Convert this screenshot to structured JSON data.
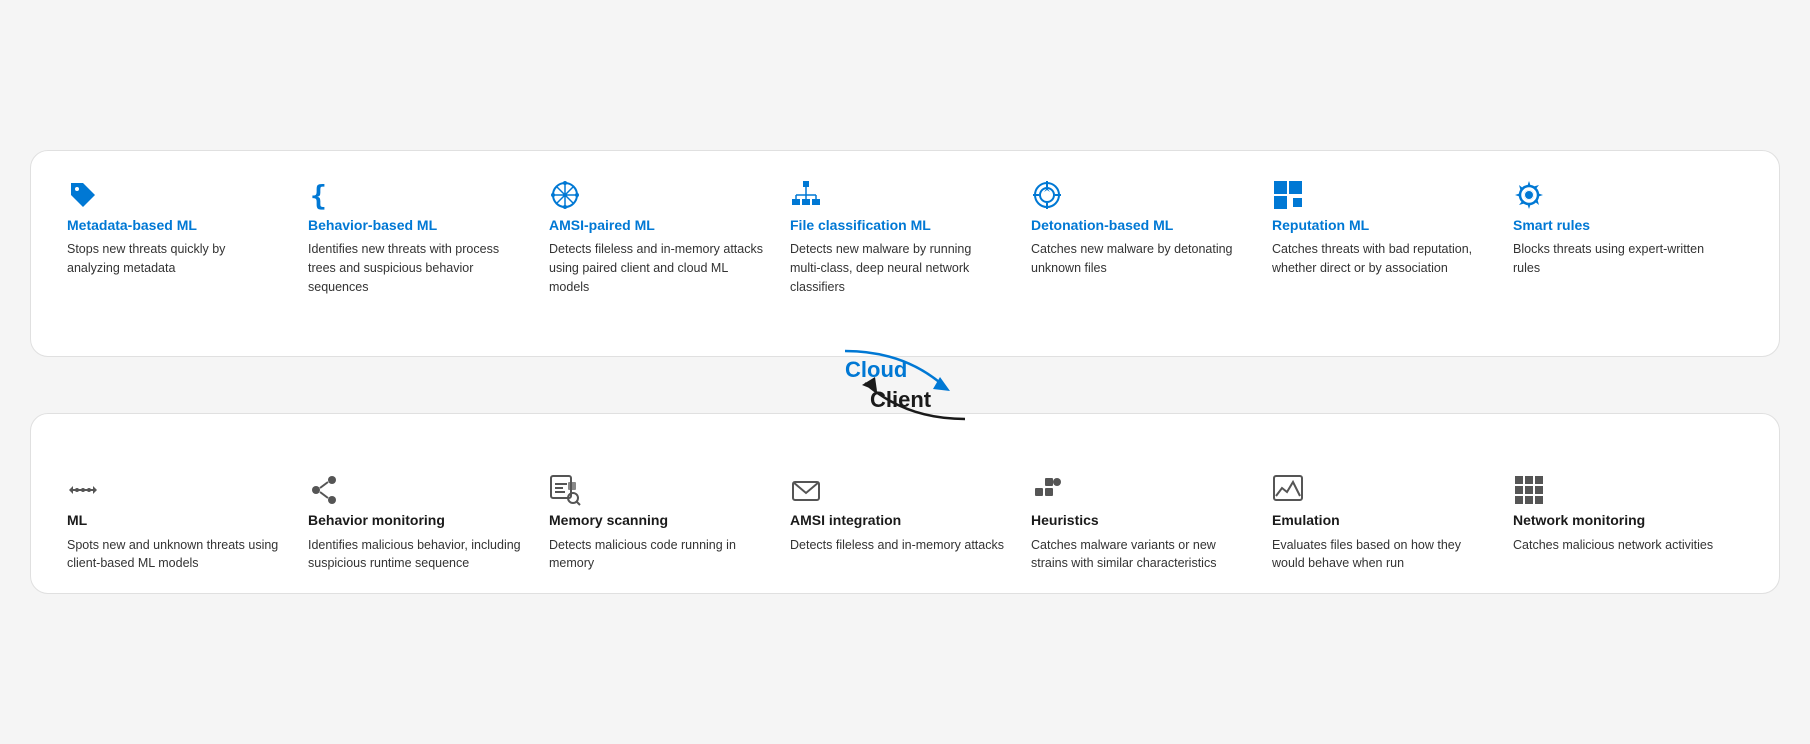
{
  "cloud": {
    "label": "Cloud",
    "items": [
      {
        "id": "metadata-ml",
        "icon": "tag",
        "title": "Metadata-based ML",
        "desc": "Stops new threats quickly by analyzing metadata",
        "color": "blue"
      },
      {
        "id": "behavior-ml",
        "icon": "braces",
        "title": "Behavior-based ML",
        "desc": "Identifies new threats with process trees and suspicious behavior sequences",
        "color": "blue"
      },
      {
        "id": "amsi-ml",
        "icon": "network",
        "title": "AMSI-paired ML",
        "desc": "Detects fileless and in-memory attacks using paired client and cloud ML models",
        "color": "blue"
      },
      {
        "id": "file-classification-ml",
        "icon": "hierarchy",
        "title": "File classification ML",
        "desc": "Detects new malware by running multi-class, deep neural network classifiers",
        "color": "blue"
      },
      {
        "id": "detonation-ml",
        "icon": "target",
        "title": "Detonation-based ML",
        "desc": "Catches new malware by detonating unknown files",
        "color": "blue"
      },
      {
        "id": "reputation-ml",
        "icon": "squares",
        "title": "Reputation ML",
        "desc": "Catches threats with bad reputation, whether direct or by association",
        "color": "blue"
      },
      {
        "id": "smart-rules",
        "icon": "gear",
        "title": "Smart rules",
        "desc": "Blocks threats using expert-written rules",
        "color": "blue"
      }
    ]
  },
  "client": {
    "label": "Client",
    "items": [
      {
        "id": "client-ml",
        "icon": "arrows",
        "title": "ML",
        "desc": "Spots new and unknown threats using client-based ML models",
        "color": "dark"
      },
      {
        "id": "behavior-monitoring",
        "icon": "share",
        "title": "Behavior monitoring",
        "desc": "Identifies malicious behavior, including suspicious runtime sequence",
        "color": "dark"
      },
      {
        "id": "memory-scanning",
        "icon": "chart-search",
        "title": "Memory scanning",
        "desc": "Detects malicious code running in memory",
        "color": "dark"
      },
      {
        "id": "amsi-integration",
        "icon": "envelope",
        "title": "AMSI integration",
        "desc": "Detects fileless and in-memory attacks",
        "color": "dark"
      },
      {
        "id": "heuristics",
        "icon": "dots-square",
        "title": "Heuristics",
        "desc": "Catches malware variants or new strains with similar characteristics",
        "color": "dark"
      },
      {
        "id": "emulation",
        "icon": "mountain-chart",
        "title": "Emulation",
        "desc": "Evaluates files based on how they would behave when run",
        "color": "dark"
      },
      {
        "id": "network-monitoring",
        "icon": "grid",
        "title": "Network monitoring",
        "desc": "Catches malicious network activities",
        "color": "dark"
      }
    ]
  }
}
